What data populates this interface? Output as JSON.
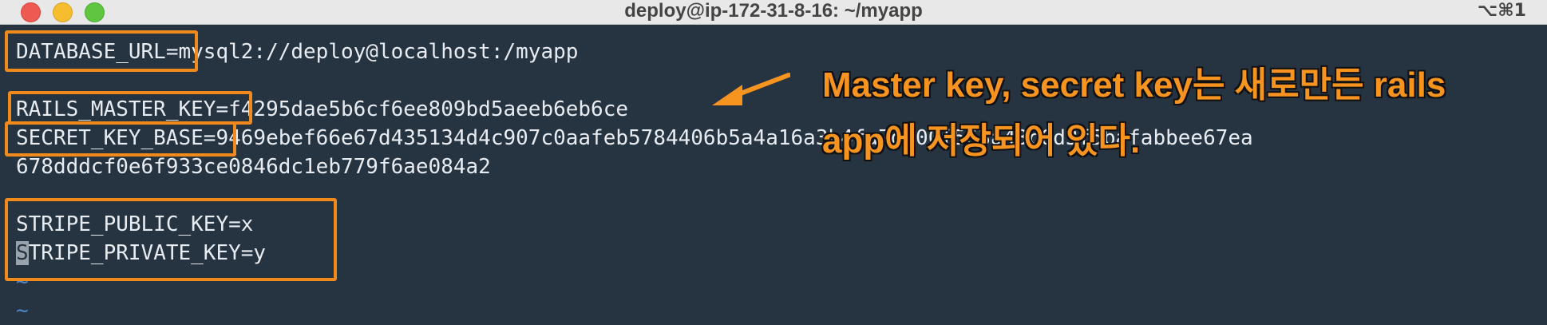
{
  "window": {
    "title": "deploy@ip-172-31-8-16: ~/myapp",
    "shortcut": "⌥⌘1"
  },
  "terminal": {
    "lines": [
      "DATABASE_URL=mysql2://deploy@localhost:/myapp",
      "",
      "RAILS_MASTER_KEY=f4295dae5b6cf6ee809bd5aeeb6eb6ce",
      "SECRET_KEY_BASE=9469ebef66e67d435134d4c907c0aafeb5784406",
      "678dddcf0e6f933ce0846dc1eb779f6ae084a2",
      "",
      "STRIPE_PUBLIC_KEY=x",
      "STRIPE_PRIVATE_KEY=y"
    ],
    "secret_key_tail": "b5a4a16a3b4fa7d400f563a43c6d3f5bafabbee67ea",
    "cursor_char": "S",
    "after_cursor": "TRIPE_PRIVATE_KEY=y",
    "tilde": "~"
  },
  "annotation": {
    "line1": "Master key, secret key는 새로만든 rails",
    "line2": "app에 저장되어 있다."
  },
  "colors": {
    "highlight": "#f08a1c",
    "annotation_text": "#f79420",
    "terminal_bg": "#263341",
    "terminal_fg": "#e8ecf0",
    "tilde": "#4f86c6"
  }
}
